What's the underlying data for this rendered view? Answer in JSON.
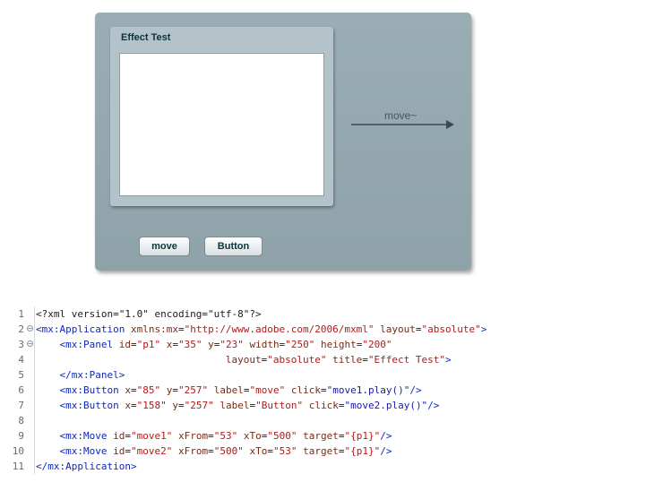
{
  "app": {
    "panel_title": "Effect Test",
    "move_label": "move~",
    "buttons": {
      "move": "move",
      "button": "Button"
    }
  },
  "code": {
    "lines": [
      {
        "num": "1",
        "indent": "",
        "parts": [
          [
            "plain",
            "<?xml version=\"1.0\" encoding=\"utf-8\"?>"
          ]
        ]
      },
      {
        "num": "2",
        "indent": "",
        "fold": true,
        "parts": [
          [
            "tag",
            "<mx:Application"
          ],
          [
            "plain",
            " "
          ],
          [
            "attr",
            "xmlns:mx"
          ],
          [
            "plain",
            "="
          ],
          [
            "val2",
            "\"http://www.adobe.com/2006/mxml\""
          ],
          [
            "plain",
            " "
          ],
          [
            "attr",
            "layout"
          ],
          [
            "plain",
            "="
          ],
          [
            "val2",
            "\"absolute\""
          ],
          [
            "tag",
            ">"
          ]
        ]
      },
      {
        "num": "3",
        "indent": "    ",
        "fold": true,
        "parts": [
          [
            "tag",
            "<mx:Panel"
          ],
          [
            "plain",
            " "
          ],
          [
            "attr",
            "id"
          ],
          [
            "plain",
            "="
          ],
          [
            "val2",
            "\"p1\""
          ],
          [
            "plain",
            " "
          ],
          [
            "attr",
            "x"
          ],
          [
            "plain",
            "="
          ],
          [
            "val2",
            "\"35\""
          ],
          [
            "plain",
            " "
          ],
          [
            "attr",
            "y"
          ],
          [
            "plain",
            "="
          ],
          [
            "val2",
            "\"23\""
          ],
          [
            "plain",
            " "
          ],
          [
            "attr",
            "width"
          ],
          [
            "plain",
            "="
          ],
          [
            "val2",
            "\"250\""
          ],
          [
            "plain",
            " "
          ],
          [
            "attr",
            "height"
          ],
          [
            "plain",
            "="
          ],
          [
            "val2",
            "\"200\""
          ]
        ]
      },
      {
        "num": "4",
        "indent": "                                ",
        "parts": [
          [
            "attr",
            "layout"
          ],
          [
            "plain",
            "="
          ],
          [
            "val2",
            "\"absolute\""
          ],
          [
            "plain",
            " "
          ],
          [
            "attr",
            "title"
          ],
          [
            "plain",
            "="
          ],
          [
            "val2",
            "\"Effect Test\""
          ],
          [
            "tag",
            ">"
          ]
        ]
      },
      {
        "num": "5",
        "indent": "    ",
        "parts": [
          [
            "tag",
            "</mx:Panel>"
          ]
        ]
      },
      {
        "num": "6",
        "indent": "    ",
        "parts": [
          [
            "tag",
            "<mx:Button"
          ],
          [
            "plain",
            " "
          ],
          [
            "attr",
            "x"
          ],
          [
            "plain",
            "="
          ],
          [
            "val2",
            "\"85\""
          ],
          [
            "plain",
            " "
          ],
          [
            "attr",
            "y"
          ],
          [
            "plain",
            "="
          ],
          [
            "val2",
            "\"257\""
          ],
          [
            "plain",
            " "
          ],
          [
            "attr",
            "label"
          ],
          [
            "plain",
            "="
          ],
          [
            "val2",
            "\"move\""
          ],
          [
            "plain",
            " "
          ],
          [
            "attr",
            "click"
          ],
          [
            "plain",
            "="
          ],
          [
            "val",
            "\"move1.play()\""
          ],
          [
            "tag",
            "/>"
          ]
        ]
      },
      {
        "num": "7",
        "indent": "    ",
        "parts": [
          [
            "tag",
            "<mx:Button"
          ],
          [
            "plain",
            " "
          ],
          [
            "attr",
            "x"
          ],
          [
            "plain",
            "="
          ],
          [
            "val2",
            "\"158\""
          ],
          [
            "plain",
            " "
          ],
          [
            "attr",
            "y"
          ],
          [
            "plain",
            "="
          ],
          [
            "val2",
            "\"257\""
          ],
          [
            "plain",
            " "
          ],
          [
            "attr",
            "label"
          ],
          [
            "plain",
            "="
          ],
          [
            "val2",
            "\"Button\""
          ],
          [
            "plain",
            " "
          ],
          [
            "attr",
            "click"
          ],
          [
            "plain",
            "="
          ],
          [
            "val",
            "\"move2.play()\""
          ],
          [
            "tag",
            "/>"
          ]
        ]
      },
      {
        "num": "8",
        "indent": "",
        "parts": []
      },
      {
        "num": "9",
        "indent": "    ",
        "parts": [
          [
            "tag",
            "<mx:Move"
          ],
          [
            "plain",
            " "
          ],
          [
            "attr",
            "id"
          ],
          [
            "plain",
            "="
          ],
          [
            "val2",
            "\"move1\""
          ],
          [
            "plain",
            " "
          ],
          [
            "attr",
            "xFrom"
          ],
          [
            "plain",
            "="
          ],
          [
            "val2",
            "\"53\""
          ],
          [
            "plain",
            " "
          ],
          [
            "attr",
            "xTo"
          ],
          [
            "plain",
            "="
          ],
          [
            "val2",
            "\"500\""
          ],
          [
            "plain",
            " "
          ],
          [
            "attr",
            "target"
          ],
          [
            "plain",
            "="
          ],
          [
            "val2",
            "\"{p1}\""
          ],
          [
            "tag",
            "/>"
          ]
        ]
      },
      {
        "num": "10",
        "indent": "    ",
        "parts": [
          [
            "tag",
            "<mx:Move"
          ],
          [
            "plain",
            " "
          ],
          [
            "attr",
            "id"
          ],
          [
            "plain",
            "="
          ],
          [
            "val2",
            "\"move2\""
          ],
          [
            "plain",
            " "
          ],
          [
            "attr",
            "xFrom"
          ],
          [
            "plain",
            "="
          ],
          [
            "val2",
            "\"500\""
          ],
          [
            "plain",
            " "
          ],
          [
            "attr",
            "xTo"
          ],
          [
            "plain",
            "="
          ],
          [
            "val2",
            "\"53\""
          ],
          [
            "plain",
            " "
          ],
          [
            "attr",
            "target"
          ],
          [
            "plain",
            "="
          ],
          [
            "val2",
            "\"{p1}\""
          ],
          [
            "tag",
            "/>"
          ]
        ]
      },
      {
        "num": "11",
        "indent": "",
        "parts": [
          [
            "tag",
            "</mx:Application>"
          ]
        ]
      }
    ]
  }
}
